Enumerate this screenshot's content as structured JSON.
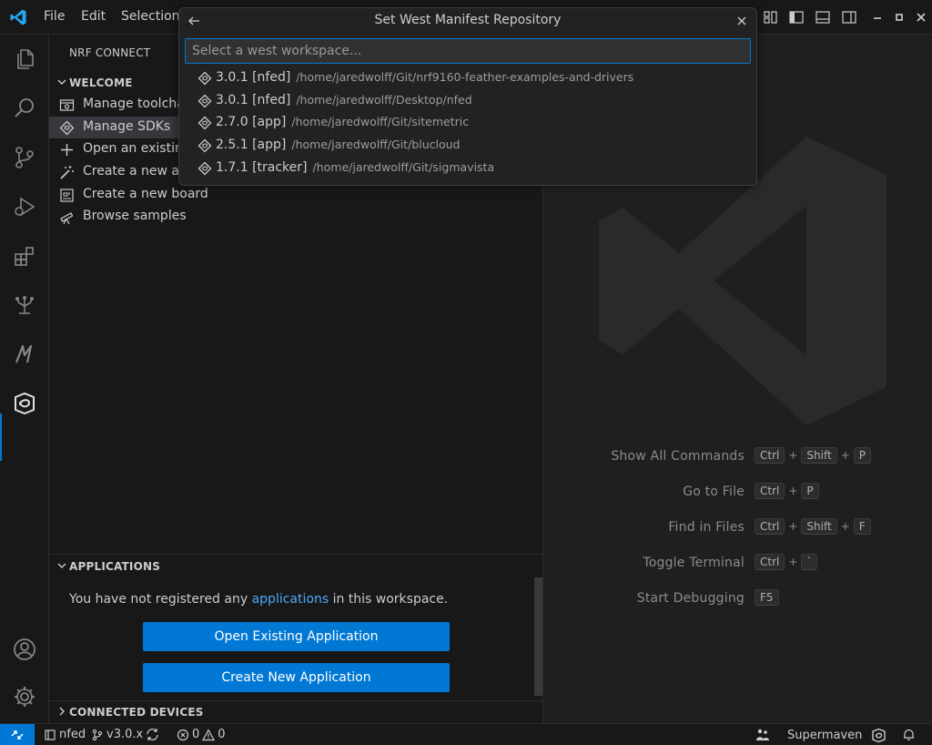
{
  "menu": {
    "file": "File",
    "edit": "Edit",
    "selection": "Selection"
  },
  "sidebar": {
    "title": "NRF CONNECT",
    "welcome": {
      "header": "WELCOME",
      "items": [
        {
          "label": "Manage toolchains",
          "icon": "toolchain-icon"
        },
        {
          "label": "Manage SDKs",
          "icon": "sdk-icon"
        },
        {
          "label": "Open an existing application",
          "icon": "plus-icon"
        },
        {
          "label": "Create a new application",
          "icon": "wand-icon"
        },
        {
          "label": "Create a new board",
          "icon": "board-icon"
        },
        {
          "label": "Browse samples",
          "icon": "telescope-icon"
        }
      ]
    },
    "applications": {
      "header": "APPLICATIONS",
      "message_pre": "You have not registered any",
      "message_link": "applications",
      "message_post": "in this workspace.",
      "open_button": "Open Existing Application",
      "create_button": "Create New Application"
    },
    "devices": {
      "header": "CONNECTED DEVICES"
    }
  },
  "quickpick": {
    "title": "Set West Manifest Repository",
    "placeholder": "Select a west workspace...",
    "items": [
      {
        "label": "3.0.1 [nfed]",
        "path": "/home/jaredwolff/Git/nrf9160-feather-examples-and-drivers"
      },
      {
        "label": "3.0.1 [nfed]",
        "path": "/home/jaredwolff/Desktop/nfed"
      },
      {
        "label": "2.7.0 [app]",
        "path": "/home/jaredwolff/Git/sitemetric"
      },
      {
        "label": "2.5.1 [app]",
        "path": "/home/jaredwolff/Git/blucloud"
      },
      {
        "label": "1.7.1 [tracker]",
        "path": "/home/jaredwolff/Git/sigmavista"
      }
    ]
  },
  "editor": {
    "shortcuts": [
      {
        "label": "Show All Commands",
        "keys": [
          "Ctrl",
          "Shift",
          "P"
        ]
      },
      {
        "label": "Go to File",
        "keys": [
          "Ctrl",
          "P"
        ]
      },
      {
        "label": "Find in Files",
        "keys": [
          "Ctrl",
          "Shift",
          "F"
        ]
      },
      {
        "label": "Toggle Terminal",
        "keys": [
          "Ctrl",
          "`"
        ]
      },
      {
        "label": "Start Debugging",
        "keys": [
          "F5"
        ]
      }
    ]
  },
  "statusbar": {
    "workspace": "nfed",
    "branch": "v3.0.x",
    "errors": "0",
    "warnings": "0",
    "supermaven": "Supermaven"
  },
  "colors": {
    "accent": "#0078d4",
    "link": "#4daafc"
  }
}
